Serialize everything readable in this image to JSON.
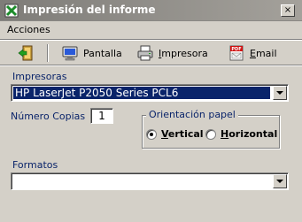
{
  "window": {
    "title": "Impresión del informe",
    "close_glyph": "×"
  },
  "menu": {
    "items": [
      {
        "label": "Acciones"
      }
    ]
  },
  "toolbar": {
    "buttons": [
      {
        "id": "exit",
        "label": "",
        "icon": "exit-door-icon"
      },
      {
        "id": "screen",
        "label": "Pantalla",
        "icon": "monitor-icon"
      },
      {
        "id": "printer",
        "label": "Impresora",
        "icon": "printer-icon"
      },
      {
        "id": "email",
        "label": "Email",
        "icon": "pdf-email-icon"
      }
    ]
  },
  "form": {
    "printers_label": "Impresoras",
    "printer_selected": "HP LaserJet P2050 Series PCL6",
    "copies_label": "Número Copias",
    "copies_value": "1",
    "orientation": {
      "title": "Orientación papel",
      "options": [
        {
          "label": "Vertical",
          "checked": true
        },
        {
          "label": "Horizontal",
          "checked": false
        }
      ]
    },
    "formats_label": "Formatos",
    "format_selected": ""
  },
  "colors": {
    "titlebar": "#7e7c78",
    "dialog_bg": "#d4d0c8",
    "selection": "#0a246a",
    "label_blue": "#0a246a"
  }
}
